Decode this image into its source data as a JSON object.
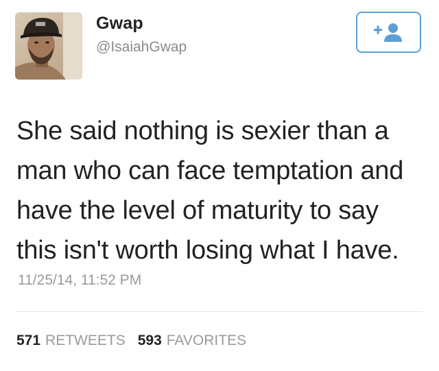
{
  "user": {
    "display_name": "Gwap",
    "handle": "@IsaiahGwap",
    "avatar_icon": "profile-photo"
  },
  "follow_button": {
    "icon": "add-user-icon",
    "accent": "#5b9fd6"
  },
  "tweet": {
    "text": "She said nothing is sexier than a\nman who can face temptation and\nhave the level of maturity to say\nthis isn't worth losing what I have.",
    "timestamp": "11/25/14, 11:52 PM"
  },
  "stats": {
    "retweets_count": "571",
    "retweets_label": "RETWEETS",
    "favorites_count": "593",
    "favorites_label": "FAVORITES"
  }
}
